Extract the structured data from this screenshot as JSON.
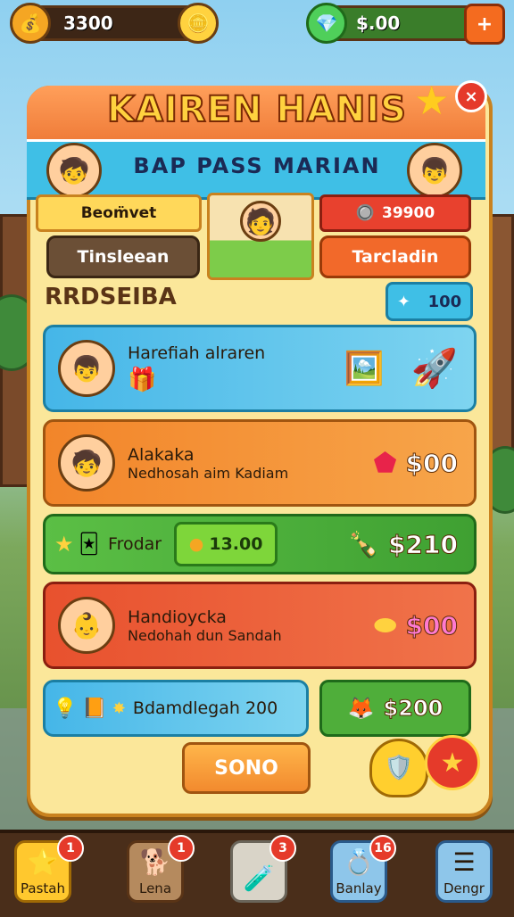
{
  "topbar": {
    "coins": "3300",
    "money": "$.00",
    "plus_label": "+"
  },
  "panel": {
    "title": "KAIREN HANIS",
    "banner": "BAP PASS MARIAN",
    "close_label": "×"
  },
  "tabs": {
    "left_label": "Beom̈vet",
    "right_value": "39900",
    "btn_left": "Tinsleean",
    "btn_right": "Tarcladin"
  },
  "section": {
    "title": "RRDSEIBA",
    "counter": "100"
  },
  "cards": [
    {
      "title": "Harefiah alraren",
      "sub": ""
    },
    {
      "title": "Alakaka",
      "sub": "Nedhosah aim Kadiam",
      "price": "$00"
    },
    {
      "title": "Frodar",
      "mid_price": "13.00",
      "price": "$210"
    },
    {
      "title": "Handioycka",
      "sub": "Nedohah dun Sandah",
      "price": "$00"
    },
    {
      "title": "Bdamdlegah 200",
      "price": "$200"
    }
  ],
  "footer_button": "SONO",
  "nav": [
    {
      "label": "Pastah",
      "badge": "1"
    },
    {
      "label": "Lena",
      "badge": "1"
    },
    {
      "label": "",
      "badge": "3"
    },
    {
      "label": "Banlay",
      "badge": "16"
    },
    {
      "label": "Dengr",
      "badge": ""
    }
  ],
  "colors": {
    "panel_bg": "#fbe79a",
    "banner": "#3fbfe6",
    "orange": "#f28a2e",
    "green": "#4fae3a",
    "red": "#e8512e",
    "blue": "#45b6e8"
  }
}
